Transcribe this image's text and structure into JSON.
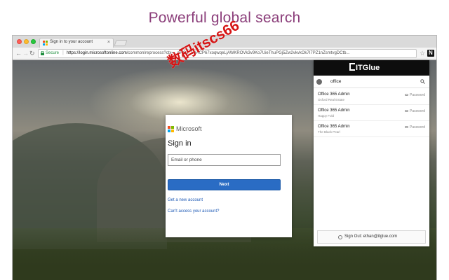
{
  "headline": "Powerful global search",
  "browser": {
    "tab": {
      "title": "Sign in to your account",
      "close": "×"
    },
    "toolbar": {
      "back": "←",
      "forward": "→",
      "reload": "↻",
      "secure_label": "Secure",
      "url_host": "https://login.microsoftonline.com",
      "url_path": "/common/reprocess?ctx=...nRO2_1UACP67xoqwqeLjAWKROVk3v9Ko7UieThuPGj5Zw2vkvkOk7I7PZ1nZsmtvgDCtb...",
      "star": "☆",
      "ext_label": "N"
    }
  },
  "ms_login": {
    "brand": "Microsoft",
    "heading": "Sign in",
    "email_placeholder": "Email or phone",
    "next_label": "Next",
    "link_new": "Get a new account",
    "link_cant": "Can't access your account?"
  },
  "itglue": {
    "logo_text": "ITGlue",
    "search_query": "office",
    "results": [
      {
        "title": "Office 365 Admin",
        "org": "Oxford Real Estate",
        "type": "Password"
      },
      {
        "title": "Office 365 Admin",
        "org": "Happy Fold",
        "type": "Password"
      },
      {
        "title": "Office 365 Admin",
        "org": "The Black Pearl",
        "type": "Password"
      }
    ],
    "signout_label": "Sign Out: ethan@itglue.com"
  },
  "watermark": "数码itscs66",
  "colors": {
    "headline": "#8b3e7a",
    "ms_button": "#2a6cc4",
    "ms_link": "#1e5ab5",
    "itg_header": "#0d0d0d",
    "secure": "#1e8e3e",
    "watermark": "#d61515"
  }
}
